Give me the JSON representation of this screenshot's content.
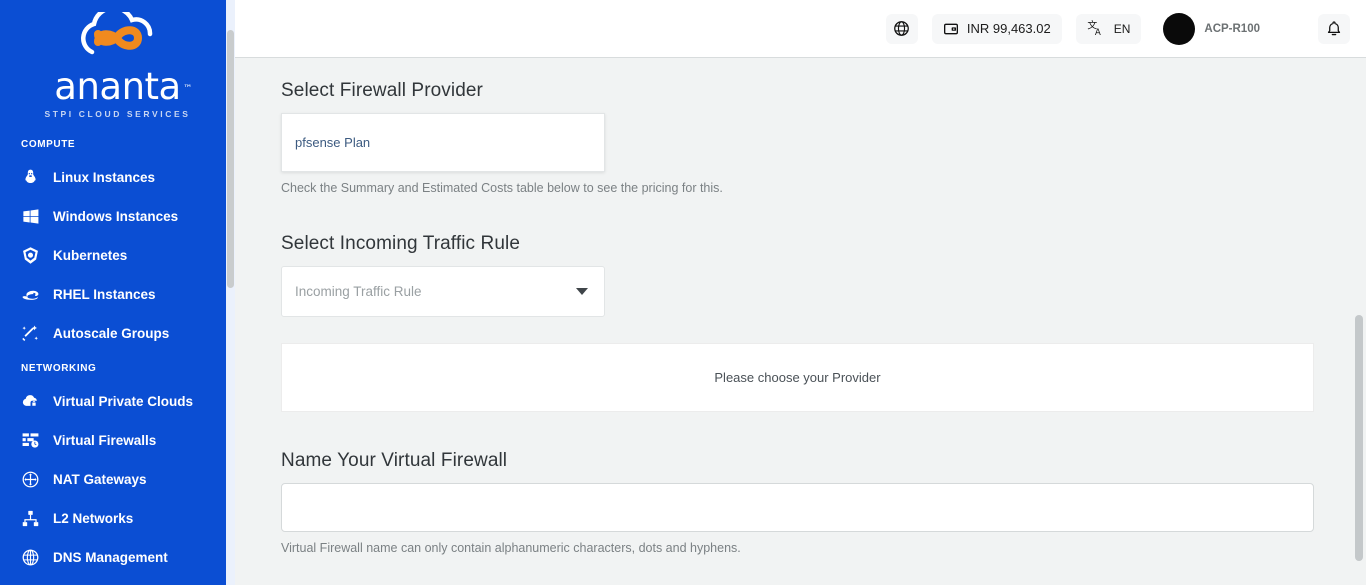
{
  "brand": {
    "name": "ananta",
    "trademark": "™",
    "tagline": "STPI CLOUD SERVICES",
    "logo_icon": "infinity-cloud-logo",
    "sidebar_color": "#0b4ed3",
    "accent_color": "#f08a1e"
  },
  "sidebar": {
    "sections": [
      {
        "label": "COMPUTE",
        "items": [
          {
            "label": "Linux Instances",
            "icon": "linux-penguin-icon",
            "name": "sidebar-item-linux-instances"
          },
          {
            "label": "Windows Instances",
            "icon": "windows-logo-icon",
            "name": "sidebar-item-windows-instances"
          },
          {
            "label": "Kubernetes",
            "icon": "kubernetes-icon",
            "name": "sidebar-item-kubernetes"
          },
          {
            "label": "RHEL Instances",
            "icon": "redhat-fedora-icon",
            "name": "sidebar-item-rhel-instances"
          },
          {
            "label": "Autoscale Groups",
            "icon": "magic-wand-icon",
            "name": "sidebar-item-autoscale-groups"
          }
        ]
      },
      {
        "label": "NETWORKING",
        "items": [
          {
            "label": "Virtual Private Clouds",
            "icon": "cloud-lock-icon",
            "name": "sidebar-item-virtual-private-clouds"
          },
          {
            "label": "Virtual Firewalls",
            "icon": "firewall-icon",
            "name": "sidebar-item-virtual-firewalls"
          },
          {
            "label": "NAT Gateways",
            "icon": "nat-gateway-icon",
            "name": "sidebar-item-nat-gateways"
          },
          {
            "label": "L2 Networks",
            "icon": "sitemap-icon",
            "name": "sidebar-item-l2-networks"
          },
          {
            "label": "DNS Management",
            "icon": "globe-grid-icon",
            "name": "sidebar-item-dns-management"
          }
        ]
      }
    ]
  },
  "topbar": {
    "support_icon": "lifebuoy-globe-icon",
    "wallet_icon": "wallet-icon",
    "wallet_balance": "INR 99,463.02",
    "translate_icon": "translate-icon",
    "language": "EN",
    "user_name": "ACP-R100",
    "avatar_icon": "user-avatar",
    "bell_icon": "notification-bell-icon"
  },
  "main": {
    "provider_section": {
      "title": "Select Firewall Provider",
      "selected_plan": "pfsense Plan",
      "hint": "Check the Summary and Estimated Costs table below to see the pricing for this."
    },
    "traffic_section": {
      "title": "Select Incoming Traffic Rule",
      "placeholder": "Incoming Traffic Rule",
      "caret_icon": "chevron-down-icon"
    },
    "notice": {
      "text": "Please choose your Provider"
    },
    "name_section": {
      "title": "Name Your Virtual Firewall",
      "value": "",
      "placeholder": "",
      "hint": "Virtual Firewall name can only contain alphanumeric characters, dots and hyphens."
    }
  }
}
